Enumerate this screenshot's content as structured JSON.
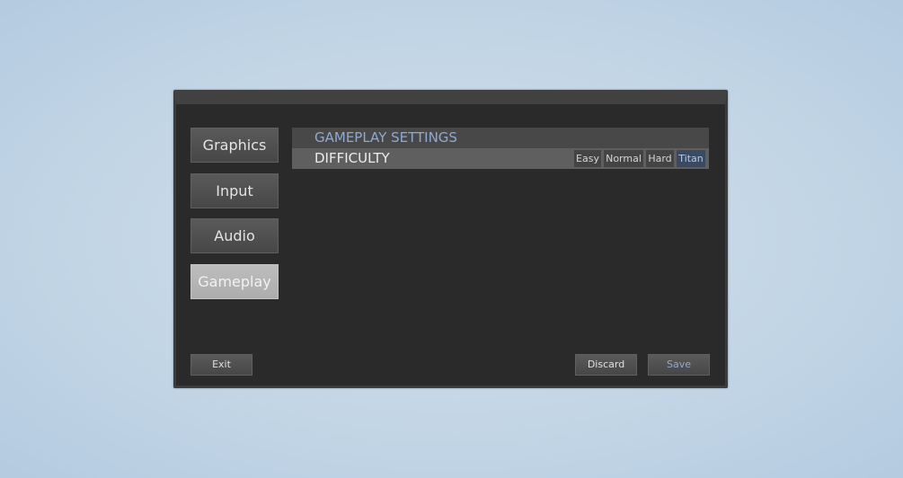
{
  "nav": {
    "items": [
      {
        "label": "Graphics",
        "active": false
      },
      {
        "label": "Input",
        "active": false
      },
      {
        "label": "Audio",
        "active": false
      },
      {
        "label": "Gameplay",
        "active": true
      }
    ]
  },
  "panel": {
    "title": "GAMEPLAY SETTINGS",
    "settings": [
      {
        "label": "DIFFICULTY",
        "options": [
          "Easy",
          "Normal",
          "Hard",
          "Titan"
        ],
        "selected": "Titan"
      }
    ]
  },
  "footer": {
    "exit_label": "Exit",
    "discard_label": "Discard",
    "save_label": "Save"
  },
  "colors": {
    "accent": "#8fa9cf",
    "selected_option_bg": "#3b4a63",
    "window_bg": "#2a2a2a"
  }
}
